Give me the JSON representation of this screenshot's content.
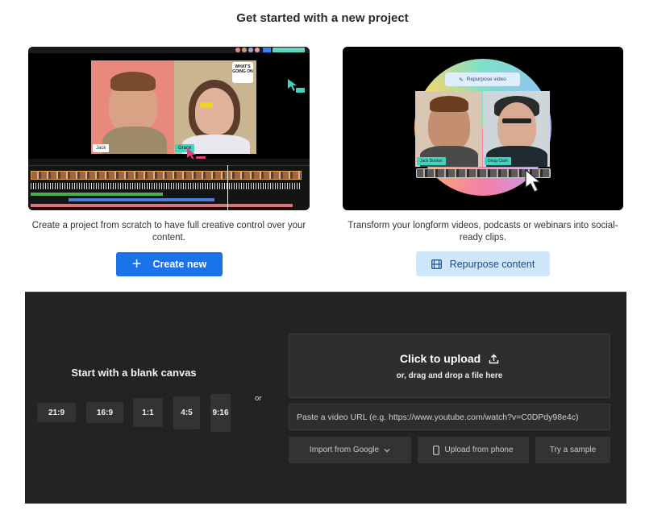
{
  "page": {
    "title": "Get started with a new project"
  },
  "create_card": {
    "description": "Create a project from scratch to have full creative control over your content.",
    "button_label": "Create new",
    "preview": {
      "left_name_tag": "Jack",
      "right_name_tag": "Grace",
      "bubble_text": "WHAT'S GOING ON"
    }
  },
  "repurpose_card": {
    "description": "Transform your longform videos, podcasts or webinars into social-ready clips.",
    "button_label": "Repurpose content",
    "preview": {
      "button_label": "Repurpose video",
      "left_name_tag": "Jack Doolan",
      "right_name_tag": "Doug Clark"
    }
  },
  "blank_canvas": {
    "title": "Start with a blank canvas",
    "ratios": [
      "21:9",
      "16:9",
      "1:1",
      "4:5",
      "9:16"
    ],
    "or_label": "or"
  },
  "upload": {
    "title": "Click to upload",
    "subtitle": "or, drag and drop a file here",
    "url_placeholder": "Paste a video URL (e.g. https://www.youtube.com/watch?v=C0DPdy98e4c)",
    "import_google": "Import from Google",
    "upload_phone": "Upload from phone",
    "try_sample": "Try a sample"
  },
  "colors": {
    "primary": "#1a73e8",
    "secondary_bg": "#cfe6fb",
    "dark_panel": "#232323"
  }
}
